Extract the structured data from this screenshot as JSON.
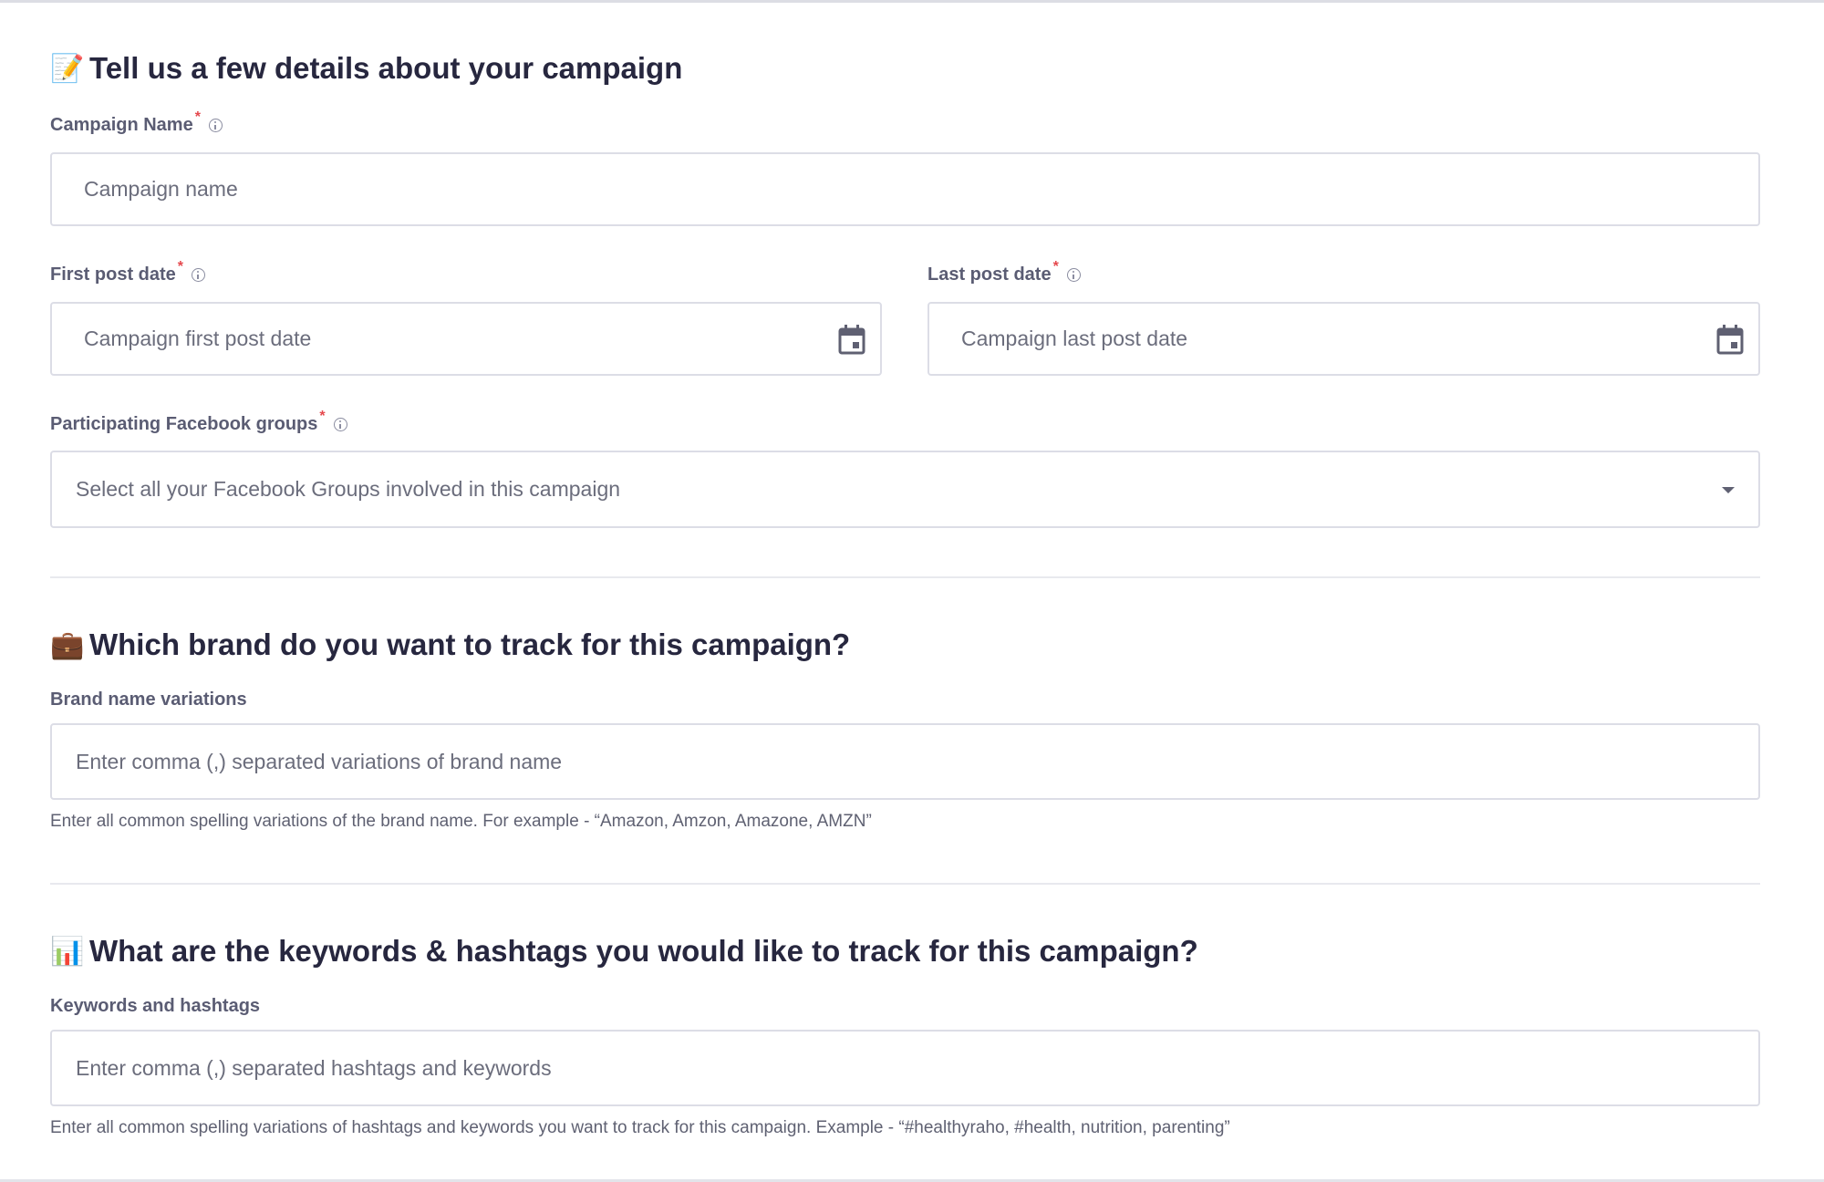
{
  "section_details": {
    "emoji": "📝",
    "title": "Tell us a few details about your campaign",
    "campaign_name": {
      "label": "Campaign Name",
      "required": "*",
      "placeholder": "Campaign name",
      "value": ""
    },
    "first_post_date": {
      "label": "First post date",
      "required": "*",
      "placeholder": "Campaign first post date",
      "value": ""
    },
    "last_post_date": {
      "label": "Last post date",
      "required": "*",
      "placeholder": "Campaign last post date",
      "value": ""
    },
    "facebook_groups": {
      "label": "Participating Facebook groups",
      "required": "*",
      "placeholder": "Select all your Facebook Groups involved in this campaign"
    }
  },
  "section_brand": {
    "emoji": "💼",
    "title": "Which brand do you want to track for this campaign?",
    "brand_variations": {
      "label": "Brand name variations",
      "placeholder": "Enter comma (,) separated variations of brand name",
      "value": "",
      "hint": "Enter all common spelling variations of the brand name. For example - “Amazon, Amzon, Amazone, AMZN”"
    }
  },
  "section_keywords": {
    "emoji": "📊",
    "title": "What are the keywords & hashtags you would like to track for this campaign?",
    "keywords": {
      "label": "Keywords and hashtags",
      "placeholder": "Enter comma (,) separated hashtags and keywords",
      "value": "",
      "hint": "Enter all common spelling variations of hashtags and keywords you want to track for this campaign. Example - “#healthyraho, #health, nutrition, parenting”"
    }
  },
  "icons": {
    "info": "info-circle-icon",
    "calendar": "calendar-icon",
    "dropdown": "caret-down-icon"
  },
  "colors": {
    "required": "#e5484d",
    "border": "#dcdde6",
    "heading": "#27273f"
  }
}
